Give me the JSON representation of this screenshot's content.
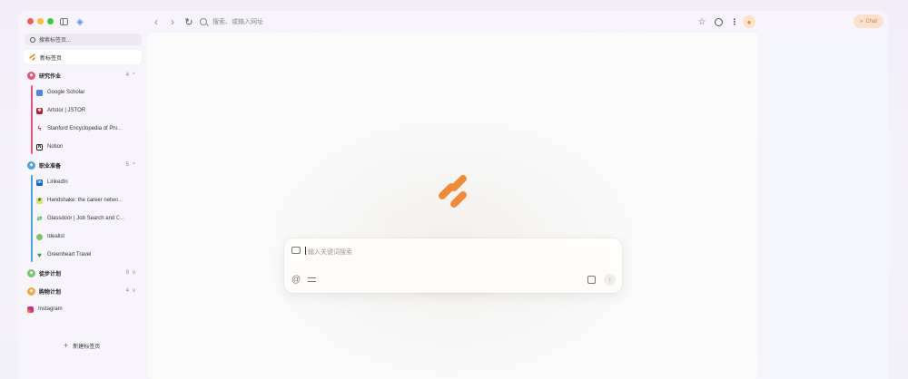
{
  "toolbar": {
    "address_placeholder": "搜索、或输入网址",
    "chat_label": "Chat"
  },
  "sidebar": {
    "search_label": "搜索标签页...",
    "new_tab_label": "新标签页",
    "groups": [
      {
        "name": "研究作业",
        "count": "4",
        "color": "#e8557a",
        "items": [
          "Google Scholar",
          "Artstor | JSTOR",
          "Stanford Encyclopedia of Phi...",
          "Notion"
        ]
      },
      {
        "name": "职业准备",
        "count": "5",
        "color": "#4aa3e0",
        "items": [
          "LinkedIn",
          "Handshake: the career netwo...",
          "Glassdoor | Job Search and C...",
          "Idealist",
          "Greenheart Travel"
        ]
      },
      {
        "name": "徒步计划",
        "count": "8",
        "color": "#7cc46a"
      },
      {
        "name": "购物计划",
        "count": "4",
        "color": "#f0a93a"
      }
    ],
    "loose_item": "Instagram",
    "new_bookmark_label": "新建标签页"
  },
  "composer": {
    "placeholder": "输入关键词搜索"
  }
}
